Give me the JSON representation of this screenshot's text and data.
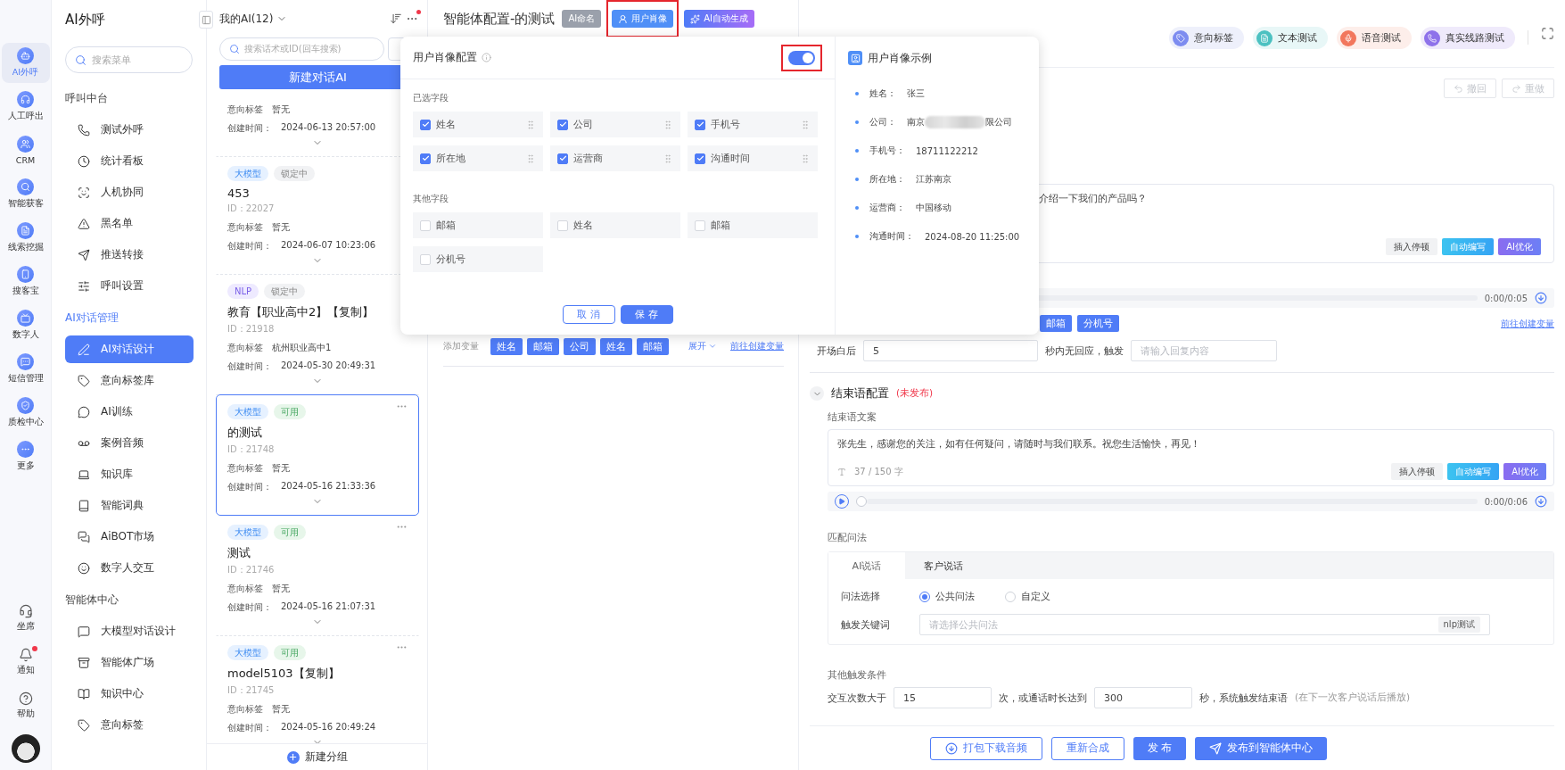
{
  "rail": {
    "items": [
      {
        "label": "AI外呼",
        "selected": true
      },
      {
        "label": "人工呼出",
        "selected": false
      },
      {
        "label": "CRM",
        "selected": false
      },
      {
        "label": "智能获客",
        "selected": false
      },
      {
        "label": "线索挖掘",
        "selected": false
      },
      {
        "label": "搜客宝",
        "selected": false
      },
      {
        "label": "数字人",
        "selected": false
      },
      {
        "label": "短信管理",
        "selected": false
      },
      {
        "label": "质检中心",
        "selected": false
      },
      {
        "label": "更多",
        "selected": false
      }
    ],
    "bottom": [
      {
        "label": "坐席",
        "badge": false
      },
      {
        "label": "通知",
        "badge": true
      },
      {
        "label": "帮助",
        "badge": false
      }
    ]
  },
  "menu": {
    "title": "AI外呼",
    "search_placeholder": "搜索菜单",
    "groups": [
      {
        "title": "呼叫中台",
        "active": false,
        "items": [
          {
            "label": "测试外呼",
            "selected": false
          },
          {
            "label": "统计看板",
            "selected": false
          },
          {
            "label": "人机协同",
            "selected": false
          },
          {
            "label": "黑名单",
            "selected": false
          },
          {
            "label": "推送转接",
            "selected": false
          },
          {
            "label": "呼叫设置",
            "selected": false
          }
        ]
      },
      {
        "title": "AI对话管理",
        "active": true,
        "items": [
          {
            "label": "AI对话设计",
            "selected": true
          },
          {
            "label": "意向标签库",
            "selected": false
          },
          {
            "label": "AI训练",
            "selected": false
          },
          {
            "label": "案例音频",
            "selected": false
          },
          {
            "label": "知识库",
            "selected": false
          },
          {
            "label": "智能词典",
            "selected": false
          },
          {
            "label": "AiBOT市场",
            "selected": false
          },
          {
            "label": "数字人交互",
            "selected": false
          }
        ]
      },
      {
        "title": "智能体中心",
        "active": false,
        "items": [
          {
            "label": "大模型对话设计",
            "selected": false
          },
          {
            "label": "智能体广场",
            "selected": false
          },
          {
            "label": "知识中心",
            "selected": false
          },
          {
            "label": "意向标签",
            "selected": false
          }
        ]
      }
    ]
  },
  "list": {
    "title": "我的AI(12)",
    "has_notification": true,
    "search_placeholder": "搜索话术或ID(回车搜索)",
    "new_button": "新建对话AI",
    "footer": "新建分组",
    "cards": [
      {
        "intent_label": "意向标签",
        "intent": "暂无",
        "created_label": "创建时间：",
        "created": "2024-06-13 20:57:00",
        "selected": false,
        "more": false
      },
      {
        "tags": [
          {
            "text": "大模型",
            "kind": "model"
          },
          {
            "text": "锁定中",
            "kind": "locked"
          }
        ],
        "name": "453",
        "id": "ID：22027",
        "intent_label": "意向标签",
        "intent": "暂无",
        "created_label": "创建时间：",
        "created": "2024-06-07 10:23:06",
        "selected": false,
        "more": false
      },
      {
        "tags": [
          {
            "text": "NLP",
            "kind": "nlp"
          },
          {
            "text": "锁定中",
            "kind": "locked"
          }
        ],
        "name": "教育【职业高中2】【复制】",
        "id": "ID：21918",
        "intent_label": "意向标签",
        "intent": "杭州职业高中1",
        "created_label": "创建时间：",
        "created": "2024-05-30 20:49:31",
        "selected": false,
        "more": false
      },
      {
        "tags": [
          {
            "text": "大模型",
            "kind": "model"
          },
          {
            "text": "可用",
            "kind": "available"
          }
        ],
        "name": "的测试",
        "id": "ID：21748",
        "intent_label": "意向标签",
        "intent": "暂无",
        "created_label": "创建时间：",
        "created": "2024-05-16 21:33:36",
        "selected": true,
        "more": true
      },
      {
        "tags": [
          {
            "text": "大模型",
            "kind": "model"
          },
          {
            "text": "可用",
            "kind": "available"
          }
        ],
        "name": "测试",
        "id": "ID：21746",
        "intent_label": "意向标签",
        "intent": "暂无",
        "created_label": "创建时间：",
        "created": "2024-05-16 21:07:31",
        "selected": false,
        "more": true
      },
      {
        "tags": [
          {
            "text": "大模型",
            "kind": "model"
          },
          {
            "text": "可用",
            "kind": "available"
          }
        ],
        "name": "model5103【复制】",
        "id": "ID：21745",
        "intent_label": "意向标签",
        "intent": "暂无",
        "created_label": "创建时间：",
        "created": "2024-05-16 20:49:24",
        "selected": false,
        "more": true
      }
    ]
  },
  "header": {
    "title": "智能体配置-的测试",
    "tags": [
      {
        "text": "AI命名",
        "kind": "rename",
        "highlighted": false
      },
      {
        "text": "用户肖像",
        "kind": "portrait",
        "highlighted": true
      },
      {
        "text": "AI自动生成",
        "kind": "generate",
        "highlighted": false
      }
    ]
  },
  "variables": {
    "label": "添加变量",
    "chips": [
      "姓名",
      "邮箱",
      "公司",
      "姓名",
      "邮箱"
    ],
    "expand": "展开",
    "link": "前往创建变量"
  },
  "popup": {
    "title": "用户肖像配置",
    "enabled": true,
    "toggle_highlighted": true,
    "selected_title": "已选字段",
    "selected_fields": [
      {
        "label": "姓名",
        "checked": true
      },
      {
        "label": "公司",
        "checked": true
      },
      {
        "label": "手机号",
        "checked": true
      },
      {
        "label": "所在地",
        "checked": true
      },
      {
        "label": "运营商",
        "checked": true
      },
      {
        "label": "沟通时间",
        "checked": true
      }
    ],
    "other_title": "其他字段",
    "other_fields": [
      {
        "label": "邮箱",
        "checked": false
      },
      {
        "label": "姓名",
        "checked": false
      },
      {
        "label": "邮箱",
        "checked": false
      },
      {
        "label": "分机号",
        "checked": false
      }
    ],
    "cancel": "取 消",
    "save": "保 存",
    "example": {
      "title": "用户肖像示例",
      "rows": [
        {
          "label": "姓名：",
          "value": "张三",
          "blurred": false
        },
        {
          "label": "公司：",
          "value": "南京",
          "blurred": true,
          "value_tail": "限公司"
        },
        {
          "label": "手机号：",
          "value": "18711122212",
          "blurred": false
        },
        {
          "label": "所在地：",
          "value": "江苏南京",
          "blurred": false
        },
        {
          "label": "运营商：",
          "value": "中国移动",
          "blurred": false
        },
        {
          "label": "沟通时间：",
          "value": "2024-08-20 11:25:00",
          "blurred": false
        }
      ]
    }
  },
  "right": {
    "tools": [
      {
        "label": "意向标签",
        "kind": "intent"
      },
      {
        "label": "文本测试",
        "kind": "text"
      },
      {
        "label": "语音测试",
        "kind": "voice"
      },
      {
        "label": "真实线路测试",
        "kind": "line"
      }
    ],
    "undo": {
      "label": "撤回",
      "disabled": true
    },
    "redo": {
      "label": "重做",
      "disabled": true
    },
    "opening": {
      "text": "介绍一下我们的产品吗？",
      "actions": [
        {
          "label": "插入停顿",
          "kind": "plain"
        },
        {
          "label": "自动编写",
          "kind": "auto"
        },
        {
          "label": "AI优化",
          "kind": "ai"
        }
      ],
      "time": "0:00/0:05",
      "chips": [
        "邮箱",
        "分机号"
      ],
      "link": "前往创建变量"
    },
    "timeout": {
      "prefix": "开场白后",
      "value": "5",
      "middle": "秒内无回应，触发",
      "placeholder": "请输入回复内容"
    },
    "closing": {
      "title": "结束语配置",
      "status": "(未发布)",
      "expanded": true,
      "copy_label": "结束语文案",
      "text": "张先生，感谢您的关注，如有任何疑问，请随时与我们联系。祝您生活愉快，再见！",
      "count": "37 / 150 字",
      "actions": [
        {
          "label": "插入停顿",
          "kind": "plain"
        },
        {
          "label": "自动编写",
          "kind": "auto"
        },
        {
          "label": "AI优化",
          "kind": "ai"
        }
      ],
      "time": "0:00/0:06",
      "level": 0
    },
    "match": {
      "title": "匹配问法",
      "tabs": [
        {
          "label": "AI说话",
          "selected": true
        },
        {
          "label": "客户说话",
          "selected": false
        }
      ],
      "mode_label": "问法选择",
      "modes": [
        {
          "label": "公共问法",
          "selected": true
        },
        {
          "label": "自定义",
          "selected": false
        }
      ],
      "keyword_label": "触发关键词",
      "keyword_placeholder": "请选择公共问法",
      "keyword_tag": "nlp测试"
    },
    "other": {
      "title": "其他触发条件",
      "p1": "交互次数大于",
      "count": "15",
      "p2": "次，或通话时长达到",
      "duration": "300",
      "p3": "秒，系统触发结束语",
      "note": "(在下一次客户说话后播放)"
    },
    "footer": [
      {
        "label": "打包下载音频",
        "kind": "download"
      },
      {
        "label": "重新合成",
        "kind": "outline"
      },
      {
        "label": "发 布",
        "kind": "primary"
      },
      {
        "label": "发布到智能体中心",
        "kind": "publish"
      }
    ]
  }
}
